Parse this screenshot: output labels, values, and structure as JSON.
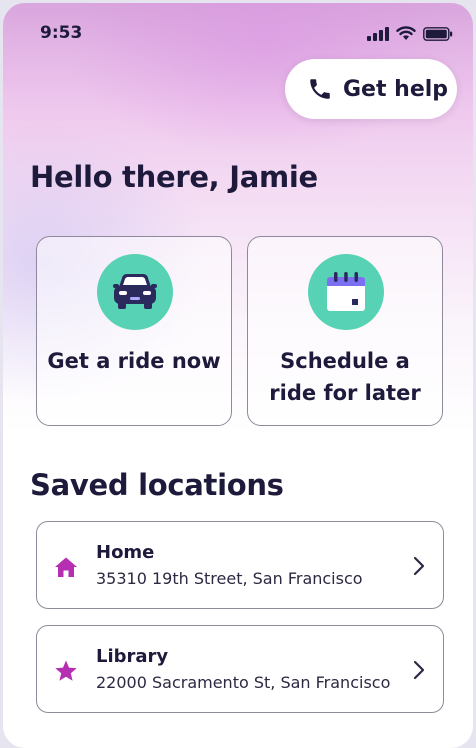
{
  "status_bar": {
    "time": "9:53",
    "signal_icon": "cellular-signal-icon",
    "wifi_icon": "wifi-icon",
    "battery_icon": "battery-icon"
  },
  "header": {
    "help_button_label": "Get help",
    "help_icon": "phone-icon"
  },
  "greeting": "Hello there, Jamie",
  "actions": [
    {
      "label": "Get a ride now",
      "icon": "car-icon"
    },
    {
      "label": "Schedule a ride for later",
      "icon": "calendar-icon"
    }
  ],
  "saved_locations": {
    "title": "Saved locations",
    "items": [
      {
        "name": "Home",
        "address": "35310 19th Street, San Francisco",
        "icon": "home-icon"
      },
      {
        "name": "Library",
        "address": "22000 Sacramento St, San Francisco",
        "icon": "star-icon"
      }
    ]
  },
  "colors": {
    "accent_teal": "#57d2b5",
    "location_icon_magenta": "#b62fb2",
    "text_dark": "#1d1a3b",
    "car_body": "#2a2a5c"
  }
}
